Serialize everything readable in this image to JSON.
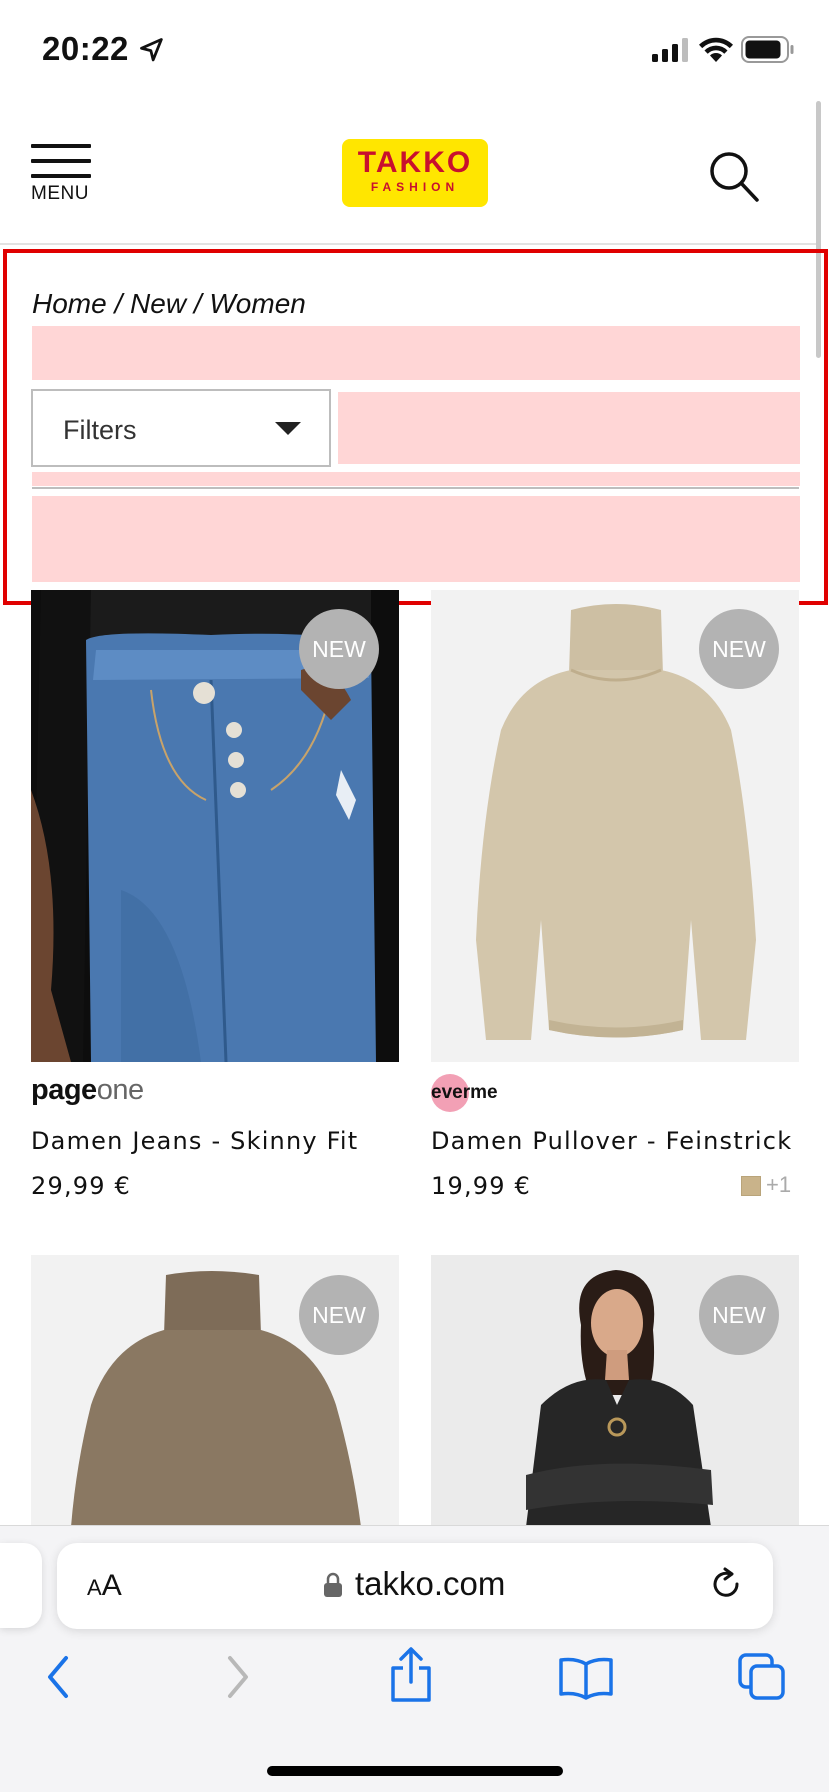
{
  "status_bar": {
    "time": "20:22"
  },
  "header": {
    "menu_label": "MENU",
    "logo_main": "TAKKO",
    "logo_sub": "FASHION"
  },
  "breadcrumb": "Home / New / Women",
  "filters": {
    "label": "Filters"
  },
  "products": [
    {
      "badge": "NEW",
      "brand": "pageone",
      "name": "Damen Jeans - Skinny Fit",
      "price": "29,99 €"
    },
    {
      "badge": "NEW",
      "brand": "everme",
      "name": "Damen Pullover - Feinstrick",
      "price": "19,99 €",
      "more_colors": "+1",
      "swatch_color": "#c9b38a"
    },
    {
      "badge": "NEW"
    },
    {
      "badge": "NEW"
    }
  ],
  "browser": {
    "text_size": "AA",
    "url": "takko.com"
  },
  "colors": {
    "highlight": "#e00000",
    "placeholder": "#ffd6d6",
    "logo_bg": "#ffe600",
    "logo_text": "#c8102e",
    "ios_blue": "#1a73e8"
  }
}
